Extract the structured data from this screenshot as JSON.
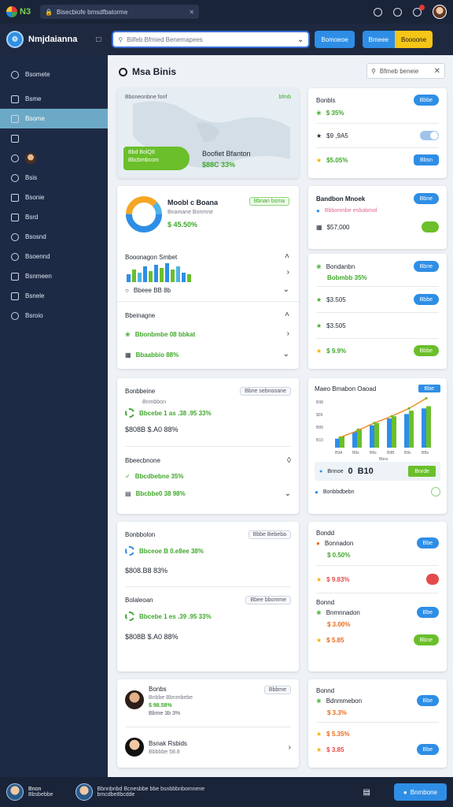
{
  "topbar": {
    "brand": "N3",
    "url": "Bisecbiofe bmsdfbatorme"
  },
  "header": {
    "brand": "Nmjdaianna",
    "search_placeholder": "Bilfeb Bfmied Benemapees",
    "btn1": "Bomoeoe",
    "btn2": "Bmeee",
    "btn3": "Boooone"
  },
  "sidebar": {
    "items": [
      "Bsomete",
      "Bsme",
      "Bsome",
      "",
      "Bsis",
      "Bsonie",
      "Bsrd",
      "Bsosnd",
      "Bsoennd",
      "Bsnmeen",
      "Bsnele",
      "Bsroio"
    ]
  },
  "main": {
    "title": "Msa Binis",
    "filter": "Bfmeb beneie",
    "map_card": {
      "caption": "Bboneonbne fonf",
      "caption_right": "bfmb",
      "pill_l1": "Bbd BolQ8",
      "pill_l2": "Bbcbmbcom",
      "title": "Boofiet Bfanton",
      "value": "$88C 33%"
    },
    "donut_card": {
      "title": "Moobl c Boana",
      "subtitle": "Bnamane Bonmne",
      "value": "$ 45.50%",
      "tag": "Bbnan bsma",
      "chart_title": "Booonagon Smbet",
      "legend": "Bbeee BB 8b",
      "sec2_title": "Bbeinagne",
      "sec2_row1": "Bbonbmbe 08 bbkat",
      "sec2_row2": "Bbaabbio 88%"
    },
    "stats_card": {
      "title": "Bonbls",
      "r1": "$ 35%",
      "r2": "$9 ,9A5",
      "r3": "$5.05%",
      "b1": "Bbbe",
      "b3": "Bbsn"
    },
    "mid_card": {
      "title": "Bandbon Mnoek",
      "sub": "Bbbonmbe enbabmol",
      "val": "$57,000",
      "b1": "Bbne"
    },
    "list_card": {
      "items": [
        {
          "title": "Bondanbn",
          "sub": "Bobmbb 35%"
        },
        {
          "value": "$3.505"
        },
        {
          "value": "$3.505"
        },
        {
          "value": "$ 9.9%"
        }
      ],
      "buttons": [
        "Bbne",
        "Bbbe",
        "Bbbe"
      ]
    },
    "sales_card": {
      "title": "Bonbbeine",
      "tag": "Bbne sebnooane",
      "r1": "Bnmbbon",
      "r1b": "Bbcebe  1 as .38 .95 33%",
      "value": "$808B $.A0  88%",
      "sec2": "Bbeecbnone",
      "s2r1": "Bbcdbebne 35%",
      "s2r2": "Bbcbbe0 38 98%"
    },
    "chart_card": {
      "title": "Maeo Bmabon Oaoad",
      "badge": "Bbe",
      "ylabels": [
        "B98",
        "$09",
        "B89",
        "B10"
      ],
      "xlabels": [
        "B9A",
        "B8s",
        "B8s",
        "B8B",
        "B8s",
        "BBs"
      ],
      "xlabel": "Bbns",
      "stat1": "Bnnoe",
      "stat2": "0",
      "stat3": "B10",
      "stat_btn": "Bnrde",
      "foot": "Bonbbdbebn"
    },
    "chart_data": {
      "type": "bar",
      "categories": [
        "B9A",
        "B8s",
        "B8s",
        "B8B",
        "B8s",
        "BBs"
      ],
      "series": [
        {
          "values": [
            8,
            14,
            20,
            26,
            30,
            35
          ]
        },
        {
          "values": [
            10,
            17,
            22,
            28,
            33,
            37
          ]
        }
      ],
      "line": [
        9,
        15,
        22,
        28,
        35,
        44
      ],
      "ylim": [
        0,
        45
      ]
    },
    "trend_card": {
      "title": "Bonbbolon",
      "tag": "Bbbe Bebeba",
      "r1": "Bbceoe  B 0.e8ee 38%",
      "value": "$808.B8 83%",
      "sec2": "Bolaleoan",
      "tag2": "Bbee bbomme",
      "s2r1": "Bbcebe  1 es .39 .95 33%",
      "s2val": "$808B $.A0  88%"
    },
    "right3_card": {
      "t1": "Bondd",
      "t2": "Bonnadon",
      "r1": "$ 0.50%",
      "r2": "$ 9.83%",
      "t3": "Bonnd",
      "t4": "Bnmnnadon",
      "r3": "$ 3.00%",
      "r4": "$ 5.85",
      "b1": "Bbe",
      "b3": "Bbe",
      "b4": "Bbne"
    },
    "people_card": {
      "p1_name": "Bonbs",
      "p1_sub": "Bnbbe Bbnmbebe",
      "p1_val": "$ 98.58%",
      "p1_val2": "Bbme 3b 3%",
      "tag": "Bbbme",
      "p2_name": "Bsnak Rsbids",
      "p2_sub": "Bbbbbe 58.8"
    },
    "right4_card": {
      "t1": "Bonnd",
      "t2": "Bdnmmebon",
      "r1": "$ 3.3%",
      "r2": "$ 5.35%",
      "r3": "$ 3.85",
      "b1": "Bbe",
      "b2": "Bbe"
    }
  },
  "bottombar": {
    "name": "Bnon",
    "status": "Bbsbebbe",
    "text": "Bbnnbnbd Bcnesbbe bbe bsnbbbnbomnene",
    "sub": "bmcdbe8bcdde",
    "button": "Bnmbone"
  }
}
